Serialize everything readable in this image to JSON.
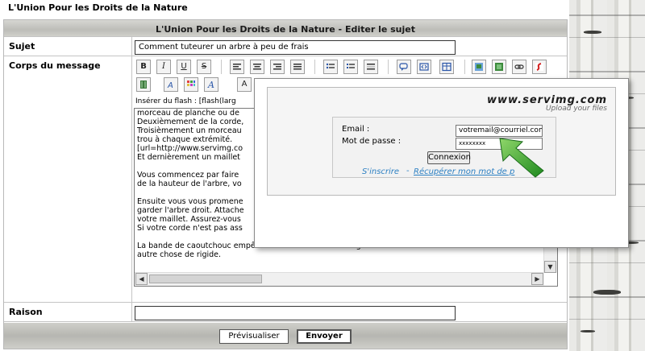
{
  "site": {
    "title": "L'Union Pour les Droits de la Nature"
  },
  "form": {
    "header": "L'Union Pour les Droits de la Nature - Editer le sujet",
    "subject_label": "Sujet",
    "subject_value": "Comment tuteurer un arbre à peu de frais",
    "body_label": "Corps du message",
    "flash_label": "Insérer du flash : [flash(larg",
    "body_lines": [
      "morceau de planche ou de",
      "Deuxièmement de la corde,",
      "Troisièmement un morceau",
      "trou à chaque extrémité.",
      "[url=http://www.servimg.co",
      "Et dernièrement un maillet",
      "",
      "Vous commencez par faire",
      "de la hauteur de l'arbre, vo",
      "",
      "Ensuite vous vous promene",
      "garder l'arbre droit. Attache",
      "votre maillet. Assurez-vous",
      "Si votre corde n'est pas ass",
      "",
      "La bande de caoutchouc empêchera le tronc d'être étranglé ou blessé comme avec une corde ou",
      "autre chose de rigide."
    ],
    "reason_label": "Raison",
    "reason_value": "",
    "preview_button": "Prévisualiser",
    "send_button": "Envoyer"
  },
  "toolbar": {
    "bold": "B",
    "italic": "I",
    "underline": "U",
    "strike": "S",
    "font_a": "A"
  },
  "servimg": {
    "logo_text": "www.servimg.com",
    "tagline": "Upload your files",
    "email_label": "Email :",
    "email_value": "votremail@courriel.com",
    "password_label": "Mot de passe :",
    "password_value": "xxxxxxxx",
    "login_button": "Connexion",
    "register_link": "S'inscrire",
    "link_separator": "-",
    "recover_link": "Récupérer mon mot de p"
  },
  "colors": {
    "link": "#2b7fc2",
    "arrow": "#2e9e2e"
  }
}
